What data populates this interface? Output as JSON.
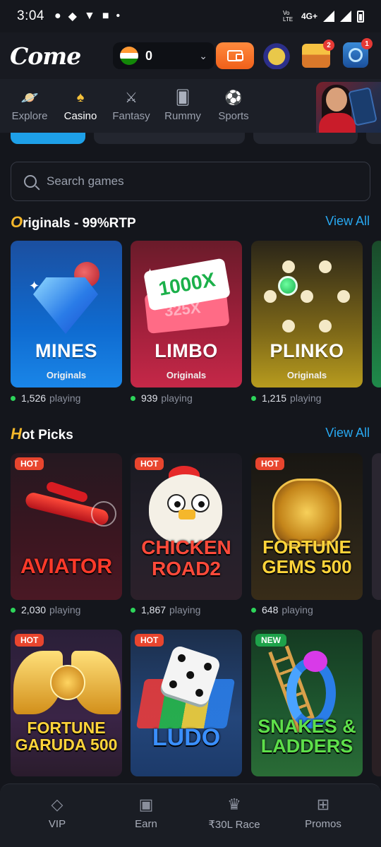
{
  "status_bar": {
    "time": "3:04",
    "network": "4G+",
    "volte": "Vo LTE"
  },
  "header": {
    "logo": "Come",
    "balance": "0",
    "colors": {
      "wallet_button": "#f0601a",
      "accent_blue": "#28a8f0",
      "gold": "#f5b72b"
    },
    "icons": [
      "india-flag-icon",
      "wallet-icon",
      "jar-icon",
      "treasure-chest-icon",
      "support-avatar-icon"
    ],
    "chest_badge": "2",
    "support_badge": "1"
  },
  "nav_tabs": [
    {
      "label": "Explore",
      "icon": "planet-icon"
    },
    {
      "label": "Casino",
      "icon": "spade-icon",
      "active": true
    },
    {
      "label": "Fantasy",
      "icon": "cricket-bat-icon"
    },
    {
      "label": "Rummy",
      "icon": "cards-icon"
    },
    {
      "label": "Sports",
      "icon": "football-icon"
    }
  ],
  "search": {
    "placeholder": "Search games"
  },
  "originals": {
    "title_first": "O",
    "title_rest": "riginals - 99%RTP",
    "view_all": "View All",
    "games": [
      {
        "name": "MINES",
        "subtitle": "Originals",
        "players": "1,526",
        "playing_label": "playing"
      },
      {
        "name": "LIMBO",
        "subtitle": "Originals",
        "players": "939",
        "playing_label": "playing",
        "art_text_1": "1000X",
        "art_text_2": "325X"
      },
      {
        "name": "PLINKO",
        "subtitle": "Originals",
        "players": "1,215",
        "playing_label": "playing"
      }
    ]
  },
  "hot_picks": {
    "title_first": "H",
    "title_rest": "ot Picks",
    "view_all": "View All",
    "games": [
      {
        "tag": "HOT",
        "line1": "AVIATOR",
        "line2": "",
        "players": "2,030",
        "playing_label": "playing"
      },
      {
        "tag": "HOT",
        "line1": "CHICKEN",
        "line2": "ROAD2",
        "players": "1,867",
        "playing_label": "playing"
      },
      {
        "tag": "HOT",
        "line1": "FORTUNE",
        "line2": "GEMS 500",
        "players": "648",
        "playing_label": "playing"
      }
    ]
  },
  "more_games": [
    {
      "tag": "HOT",
      "line1": "FORTUNE",
      "line2": "GARUDA 500"
    },
    {
      "tag": "HOT",
      "line1": "LUDO",
      "line2": ""
    },
    {
      "tag": "NEW",
      "line1": "SNAKES &",
      "line2": "LADDERS"
    }
  ],
  "bottom_nav": [
    {
      "label": "VIP",
      "icon": "diamond-icon"
    },
    {
      "label": "Earn",
      "icon": "wallet-earn-icon"
    },
    {
      "label": "₹30L Race",
      "icon": "trophy-icon"
    },
    {
      "label": "Promos",
      "icon": "gift-icon"
    }
  ]
}
